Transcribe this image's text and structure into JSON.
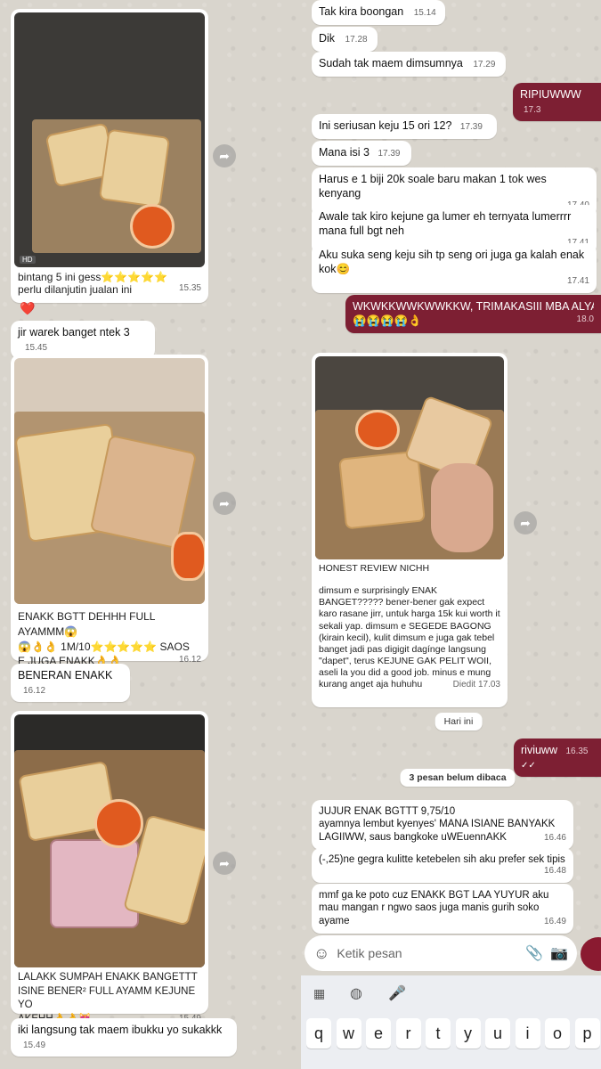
{
  "left": {
    "img1_caption": "bintang 5 ini gess⭐⭐⭐⭐⭐",
    "img1_caption2": "perlu dilanjutin jualan ini",
    "img1_time": "15.35",
    "hd_badge": "HD",
    "reaction": "❤️",
    "msg_jir": "jir warek banget ntek 3",
    "msg_jir_time": "15.45",
    "img2_caption": "ENAKK BGTT DEHHH FULL AYAMMM😱",
    "img2_caption2": "😱👌👌 1M/10⭐⭐⭐⭐⭐ SAOS",
    "img2_caption3": "E JUGA ENAKK👌👌",
    "img2_time": "16.12",
    "msg_beneran": "BENERAN ENAKK",
    "msg_beneran_time": "16.12",
    "img3_caption": "LALAKK SUMPAH ENAKK BANGETTT",
    "img3_caption2": "ISINE BENER² FULL AYAMM KEJUNE YO",
    "img3_caption3": "AKEHH👌👌😻",
    "img3_time": "15.49",
    "msg_iki": "iki langsung tak maem ibukku yo sukakkk",
    "msg_iki_time": "15.49"
  },
  "right": {
    "m1": "Tak kira boongan",
    "m1_time": "15.14",
    "m2": "Dik",
    "m2_time": "17.28",
    "m3": "Sudah tak maem dimsumnya",
    "m3_time": "17.29",
    "m4": "RIPIUWWW",
    "m4_time": "17.3",
    "m5": "Ini seriusan keju 15 ori 12?",
    "m5_time": "17.39",
    "m6": "Mana isi 3",
    "m6_time": "17.39",
    "m7": "Harus e 1 biji 20k soale baru makan 1 tok wes kenyang",
    "m7_time": "17.40",
    "m8": "Awale tak kiro kejune ga lumer eh ternyata lumerrrr mana full bgt neh",
    "m8_time": "17.41",
    "m9": "Aku suka seng keju sih tp seng ori juga ga kalah enak kok😊",
    "m9_time": "17.41",
    "m10": "WKWKKWWKWWKKW, TRIMAKASIII MBA ALYAAAA",
    "m10_line2": "😭😭😭😭👌",
    "m10_time": "18.0",
    "review_title": "HONEST REVIEW NICHH",
    "review_body": "dimsum e surprisingly ENAK BANGET????? bener-bener gak expect karo rasane jirr, untuk harga 15k kui worth it sekali yap. dimsum e SEGEDE BAGONG (kirain kecil), kulit dimsum e juga gak tebel banget jadi pas digigit dagínge langsung \"dapet\", terus KEJUNE GAK PELIT WOII, aseli la you did a good job. minus e mung kurang anget aja huhuhu",
    "review_time": "Diedit 17.03",
    "day_chip": "Hari ini",
    "m11": "riviuww",
    "m11_time": "16.35",
    "unread_chip": "3 pesan belum dibaca",
    "m12": "JUJUR ENAK BGTTT 9,75/10",
    "m12b": "ayamnya lembut kyenyes' MANA ISIANE BANYAKK LAGIIWW, saus bangkoke uWEuennAKK",
    "m12_time": "16.46",
    "m13": "(-,25)ne gegra kulitte ketebelen sih aku prefer sek tipis",
    "m13_time": "16.48",
    "m14": "mmf ga ke poto cuz ENAKK BGT LAA YUYUR aku mau mangan r ngwo saos juga manis gurih soko ayame",
    "m14_time": "16.49",
    "input_placeholder": "Ketik pesan"
  },
  "keyboard": {
    "row1": [
      "q",
      "w",
      "e",
      "r",
      "t",
      "y",
      "u",
      "i",
      "o",
      "p"
    ]
  },
  "colors": {
    "outgoing": "#7d1f33",
    "incoming": "#ffffff",
    "background": "#d9d5cd",
    "mic": "#8a1a30"
  }
}
